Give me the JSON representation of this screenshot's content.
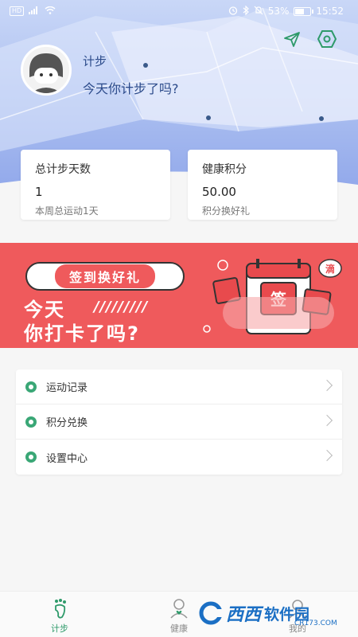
{
  "status_bar": {
    "network": "HD",
    "battery": "53%",
    "time": "15:52"
  },
  "header": {
    "icons": [
      "send-icon",
      "settings-hex-icon"
    ]
  },
  "profile": {
    "name": "计步",
    "subtitle": "今天你计步了吗?"
  },
  "stats": [
    {
      "title": "总计步天数",
      "value": "1",
      "note": "本周总运动1天"
    },
    {
      "title": "健康积分",
      "value": "50.00",
      "note": "积分换好礼"
    }
  ],
  "banner": {
    "pill": "签到换好礼",
    "line1": "今天",
    "slashes": "/////////",
    "line2": "你打卡了吗?",
    "sign_char": "签",
    "drop_char": "滴"
  },
  "menu": [
    {
      "label": "运动记录"
    },
    {
      "label": "积分兑换"
    },
    {
      "label": "设置中心"
    }
  ],
  "bottom_nav": [
    {
      "label": "计步",
      "active": true
    },
    {
      "label": "健康",
      "active": false
    },
    {
      "label": "我的",
      "active": false
    }
  ],
  "watermark": {
    "logo": "西西",
    "brand": "软件园",
    "url": "CR173.COM"
  },
  "colors": {
    "accent": "#2e9a6a",
    "banner_red": "#ef5a5c",
    "header_blue": "#8fa6ea"
  }
}
